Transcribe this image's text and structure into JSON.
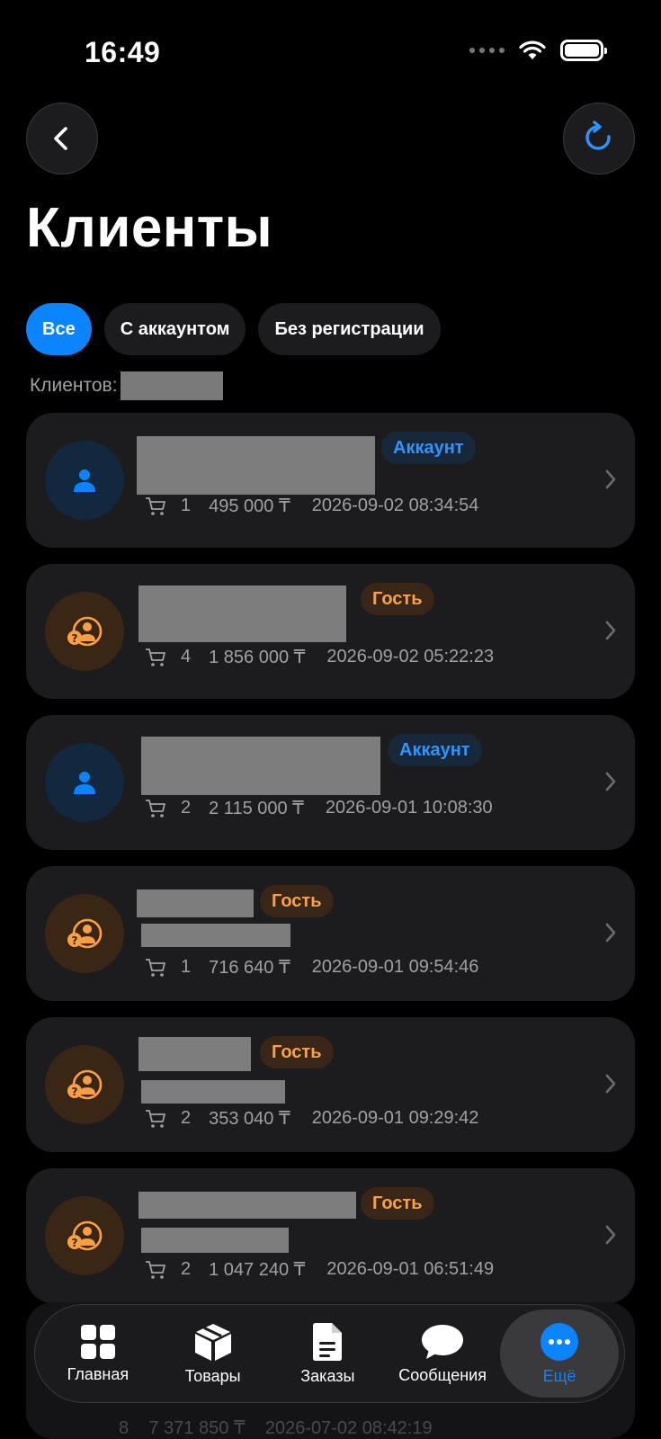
{
  "status_bar": {
    "time": "16:49"
  },
  "header": {
    "title": "Клиенты"
  },
  "filters": [
    {
      "label": "Все",
      "active": true
    },
    {
      "label": "С аккаунтом",
      "active": false
    },
    {
      "label": "Без регистрации",
      "active": false
    }
  ],
  "count_label": "Клиентов:",
  "badges": {
    "account": "Аккаунт",
    "guest": "Гость"
  },
  "clients": [
    {
      "type": "account",
      "orders": "1",
      "amount": "495 000 ₸",
      "date": "2026-09-02 08:34:54"
    },
    {
      "type": "guest",
      "orders": "4",
      "amount": "1 856 000 ₸",
      "date": "2026-09-02 05:22:23"
    },
    {
      "type": "account",
      "orders": "2",
      "amount": "2 115 000 ₸",
      "date": "2026-09-01 10:08:30"
    },
    {
      "type": "guest",
      "orders": "1",
      "amount": "716 640 ₸",
      "date": "2026-09-01 09:54:46"
    },
    {
      "type": "guest",
      "orders": "2",
      "amount": "353 040 ₸",
      "date": "2026-09-01 09:29:42"
    },
    {
      "type": "guest",
      "orders": "2",
      "amount": "1 047 240 ₸",
      "date": "2026-09-01 06:51:49"
    }
  ],
  "peek_row": {
    "orders": "8",
    "amount": "7 371 850 ₸",
    "date": "2026-07-02 08:42:19"
  },
  "bottom_nav": [
    {
      "label": "Главная",
      "icon": "grid-icon",
      "active": false
    },
    {
      "label": "Товары",
      "icon": "box-icon",
      "active": false
    },
    {
      "label": "Заказы",
      "icon": "document-icon",
      "active": false
    },
    {
      "label": "Сообщения",
      "icon": "chat-bubble-icon",
      "active": false
    },
    {
      "label": "Ещё",
      "icon": "more-icon",
      "active": true
    }
  ],
  "colors": {
    "accent": "#0a84ff",
    "guest": "#ff9f43",
    "card": "#1c1c1e",
    "background": "#000000"
  }
}
